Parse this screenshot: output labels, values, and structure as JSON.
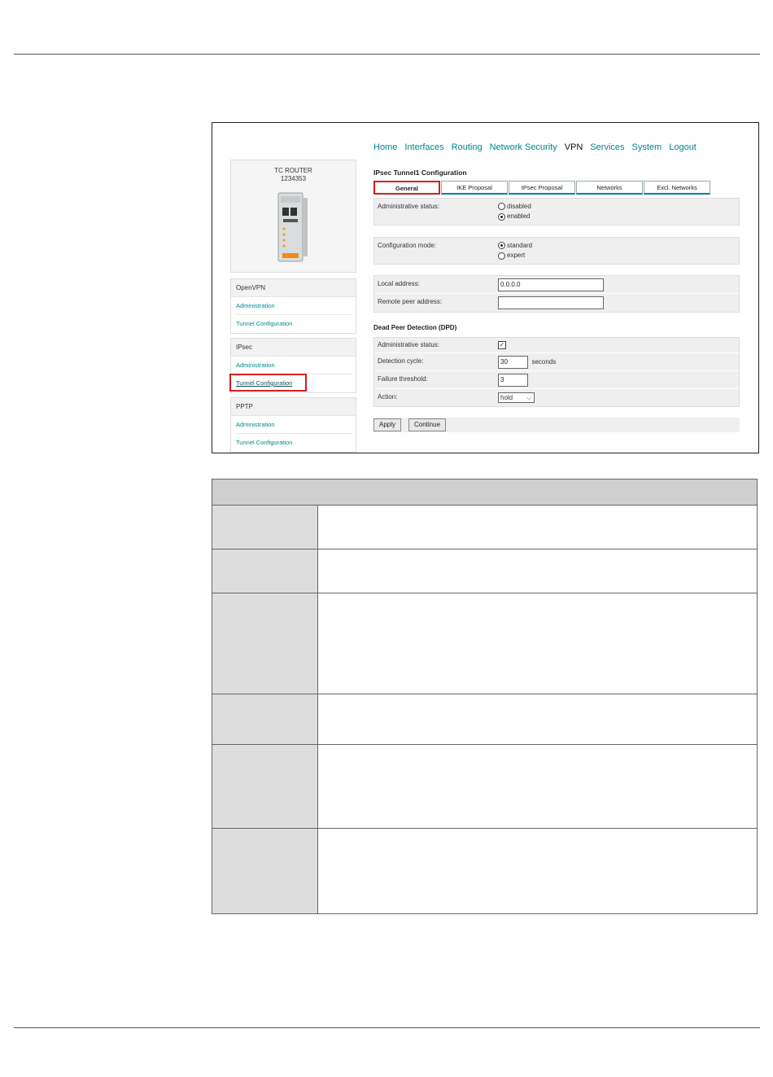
{
  "nav": {
    "items": [
      "Home",
      "Interfaces",
      "Routing",
      "Network Security",
      "VPN",
      "Services",
      "System",
      "Logout"
    ],
    "active": "VPN"
  },
  "device": {
    "name": "TC ROUTER",
    "number": "1234353"
  },
  "sidebar": {
    "openvpn": {
      "title": "OpenVPN",
      "items": [
        "Administration",
        "Tunnel Configuration"
      ]
    },
    "ipsec": {
      "title": "IPsec",
      "items": [
        "Administration",
        "Tunnel Configuration"
      ]
    },
    "pptp": {
      "title": "PPTP",
      "items": [
        "Administration",
        "Tunnel Configuration"
      ]
    }
  },
  "config": {
    "title": "IPsec Tunnel1 Configuration",
    "tabs": [
      "General",
      "IKE Proposal",
      "IPsec Proposal",
      "Networks",
      "Excl. Networks"
    ],
    "admin_status": {
      "label": "Administrative status:",
      "options": [
        "disabled",
        "enabled"
      ],
      "selected": "enabled"
    },
    "config_mode": {
      "label": "Configuration mode:",
      "options": [
        "standard",
        "expert"
      ],
      "selected": "standard"
    },
    "local_address": {
      "label": "Local address:",
      "value": "0.0.0.0"
    },
    "remote_peer": {
      "label": "Remote peer address:",
      "value": ""
    },
    "dpd": {
      "title": "Dead Peer Detection (DPD)",
      "admin_label": "Administrative status:",
      "admin_checked": true,
      "cycle_label": "Detection cycle:",
      "cycle_value": "30",
      "cycle_unit": "seconds",
      "failure_label": "Failure threshold:",
      "failure_value": "3",
      "action_label": "Action:",
      "action_value": "hold"
    },
    "buttons": {
      "apply": "Apply",
      "continue": "Continue"
    }
  },
  "colors": {
    "accent": "#00878f",
    "highlight": "#d21f1f"
  }
}
